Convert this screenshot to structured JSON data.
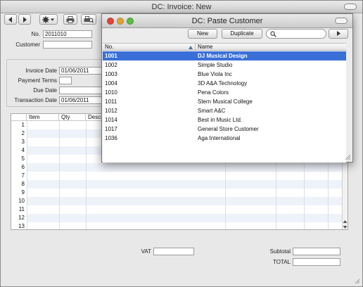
{
  "main_window": {
    "title": "DC: Invoice: New",
    "toolbar": {
      "prev_icon": "arrow-left-icon",
      "next_icon": "arrow-right-icon",
      "operations_icon": "gear-icon",
      "print_icon": "printer-icon",
      "preview_icon": "print-preview-icon"
    },
    "fields": {
      "no_label": "No.",
      "no_value": "2011010",
      "customer_label": "Customer",
      "customer_value": "",
      "invoice_date_label": "Invoice Date",
      "invoice_date_value": "01/06/2011",
      "payment_terms_label": "Payment Terms",
      "payment_terms_value": "",
      "due_date_label": "Due Date",
      "due_date_value": "",
      "transaction_date_label": "Transaction Date",
      "transaction_date_value": "01/06/2011"
    },
    "grid": {
      "columns": [
        "Item",
        "Qty",
        "Descri"
      ],
      "row_numbers": [
        "1",
        "2",
        "3",
        "4",
        "5",
        "6",
        "7",
        "8",
        "9",
        "10",
        "11",
        "12",
        "13"
      ]
    },
    "footer": {
      "vat_label": "VAT",
      "vat_value": "",
      "subtotal_label": "Subtotal",
      "subtotal_value": "",
      "total_label": "TOTAL",
      "total_value": ""
    }
  },
  "paste_dialog": {
    "title": "DC: Paste Customer",
    "new_label": "New",
    "duplicate_label": "Duplicate",
    "search_placeholder": "",
    "columns": {
      "no": "No.",
      "name": "Name"
    },
    "rows": [
      {
        "no": "1001",
        "name": "DJ Musical Design",
        "selected": true
      },
      {
        "no": "1002",
        "name": "Simple Studio"
      },
      {
        "no": "1003",
        "name": "Blue Viola Inc"
      },
      {
        "no": "1004",
        "name": "3D A&A Technology"
      },
      {
        "no": "1010",
        "name": "Pena Colors"
      },
      {
        "no": "1011",
        "name": "Stern Musical College"
      },
      {
        "no": "1012",
        "name": "Smart A&C"
      },
      {
        "no": "1014",
        "name": "Best in Music Ltd."
      },
      {
        "no": "1017",
        "name": "General Store Customer"
      },
      {
        "no": "1036",
        "name": "Aga International"
      }
    ]
  },
  "colors": {
    "selection": "#3a6fd8",
    "close": "#e0443e",
    "minimize": "#dea236",
    "zoom": "#5fba46"
  }
}
